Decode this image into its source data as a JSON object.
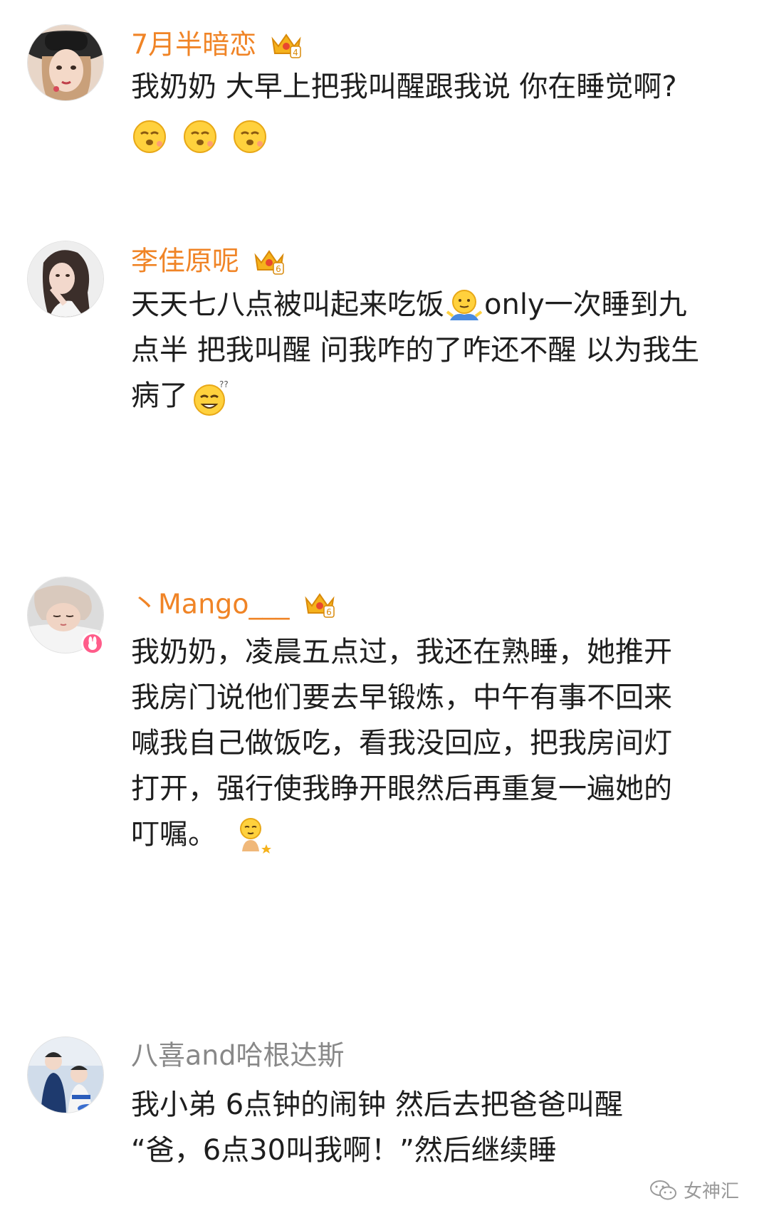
{
  "colors": {
    "vip_name": "#f08426",
    "normal_name": "#888888",
    "text": "#1e1e1e",
    "badge": "#ff5c8a"
  },
  "comments": [
    {
      "username": "7月半暗恋",
      "vip_level": "4",
      "avatar_icon": "avatar-girl-hat",
      "lines": [
        "我奶奶 大早上把我叫醒跟我说 你在睡觉啊?"
      ],
      "emojis": [
        "sleepy-emoji",
        "sleepy-emoji",
        "sleepy-emoji"
      ]
    },
    {
      "username": "李佳原呢",
      "vip_level": "6",
      "avatar_icon": "avatar-girl",
      "text_a": "天天七八点被叫起来吃饭",
      "text_b": "only一次睡到九",
      "text_c": "点半 把我叫醒 问我咋的了咋还不醒 以为我生",
      "text_d": "病了",
      "emojis": [
        "shrug-emoji",
        "dizzy-emoji"
      ]
    },
    {
      "username": "丶Mango___",
      "vip_level": "6",
      "avatar_icon": "avatar-sleeping-girl",
      "verified_badge": "rabbit-badge-icon",
      "lines": [
        "我奶奶，凌晨五点过，我还在熟睡，她推开",
        "我房门说他们要去早锻炼，中午有事不回来",
        "喊我自己做饭吃，看我没回应，把我房间灯",
        "打开，强行使我睁开眼然后再重复一遍她的",
        "叮嘱。"
      ],
      "emojis": [
        "sleepy-star-emoji"
      ]
    },
    {
      "username": "八喜and哈根达斯",
      "avatar_icon": "avatar-couple",
      "lines": [
        "我小弟 6点钟的闹钟 然后去把爸爸叫醒",
        "“爸，6点30叫我啊！”然后继续睡"
      ]
    }
  ],
  "watermark": {
    "icon": "wechat-icon",
    "label": "女神汇"
  }
}
